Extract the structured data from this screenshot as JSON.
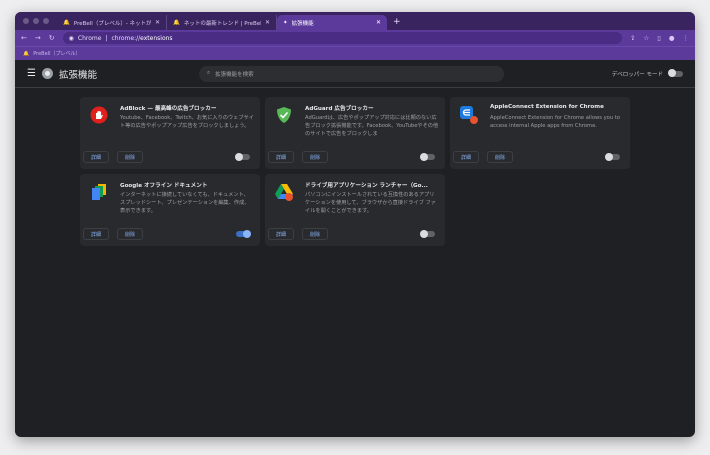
{
  "tabs": [
    {
      "label": "PreBell（プレベル）- ネットが...",
      "icon": "bell-icon"
    },
    {
      "label": "ネットの最新トレンド | PreBell",
      "icon": "bell-icon"
    },
    {
      "label": "拡張機能",
      "icon": "puzzle-icon",
      "active": true
    }
  ],
  "address": {
    "site": "Chrome",
    "url_prefix": "chrome://",
    "url_path": "extensions"
  },
  "bookmarks": [
    {
      "label": "PreBell（プレベル）"
    }
  ],
  "header": {
    "title": "拡張機能",
    "search_placeholder": "拡張機能を検索",
    "dev_mode_label": "デベロッパー モード",
    "dev_mode": false
  },
  "extensions": [
    {
      "name": "AdBlock — 最高峰の広告ブロッカー",
      "desc": "Youtube、Facebook、Twitch、お気に入りのウェブサイト等の広告やポップアップ広告をブロックしましょう。",
      "details": "詳細",
      "remove": "削除",
      "enabled": false,
      "icon": "adblock-hand-icon"
    },
    {
      "name": "AdGuard 広告ブロッカー",
      "desc": "AdGuardは、広告やポップアップ対応には比類のない広告ブロック拡張機能です。Facebook、YouTubeやその他のサイトで広告をブロックしま",
      "details": "詳細",
      "remove": "削除",
      "enabled": false,
      "icon": "adguard-shield-icon"
    },
    {
      "name": "AppleConnect Extension for Chrome",
      "desc": "AppleConnect Extension for Chrome allows you to access internal Apple apps from Chrome.",
      "details": "詳細",
      "remove": "削除",
      "enabled": false,
      "icon": "appleconnect-icon"
    },
    {
      "name": "Google オフライン ドキュメント",
      "desc": "インターネットに接続していなくても、ドキュメント、スプレッドシート、プレゼンテーションを編集、作成、表示できます。",
      "details": "詳細",
      "remove": "削除",
      "enabled": true,
      "icon": "google-docs-icon"
    },
    {
      "name": "ドライブ用アプリケーション ランチャー（Go...",
      "desc": "パソコンにインストールされている互換性のあるアプリケーションを使用して、ブラウザから直接ドライブ ファイルを開くことができます。",
      "details": "詳細",
      "remove": "削除",
      "enabled": false,
      "icon": "google-drive-icon"
    }
  ],
  "colors": {
    "accent": "#8ab4f8",
    "frame": "#5b3a9c"
  }
}
